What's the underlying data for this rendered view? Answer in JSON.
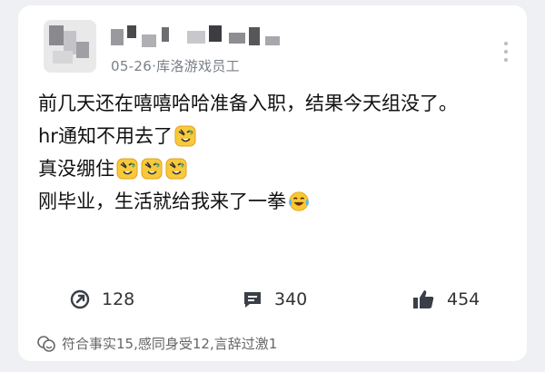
{
  "post": {
    "meta": "05-26·库洛游戏员工",
    "lines": [
      "前几天还在嘻嘻哈哈准备入职，结果今天组没了。",
      "hr通知不用去了",
      "真没绷住",
      "刚毕业，生活就给我来了一拳"
    ]
  },
  "actions": {
    "share_count": "128",
    "comment_count": "340",
    "like_count": "454"
  },
  "reactions": {
    "text": "符合事实15,感同身受12,言辞过激1"
  },
  "icons": [
    "share-icon",
    "comment-icon",
    "thumbs-up-icon",
    "more-icon",
    "reaction-icon",
    "laughing-tears-emoji",
    "salute-emoji"
  ],
  "colors": {
    "background": "#eef0f3",
    "card": "#ffffff",
    "text": "#111111",
    "meta": "#7a7f88"
  }
}
